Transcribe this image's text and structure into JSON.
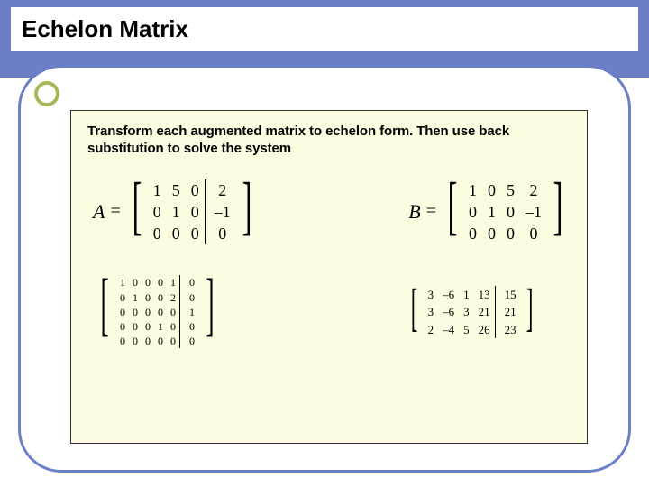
{
  "title": "Echelon Matrix",
  "instruction": "Transform each augmented matrix to echelon form. Then use back substitution to solve the system",
  "matA": {
    "label": "A",
    "rows": [
      [
        "1",
        "5",
        "0",
        "2"
      ],
      [
        "0",
        "1",
        "0",
        "–1"
      ],
      [
        "0",
        "0",
        "0",
        "0"
      ]
    ]
  },
  "matB": {
    "label": "B",
    "rows": [
      [
        "1",
        "0",
        "5",
        "2"
      ],
      [
        "0",
        "1",
        "0",
        "–1"
      ],
      [
        "0",
        "0",
        "0",
        "0"
      ]
    ]
  },
  "matC": {
    "rows": [
      [
        "1",
        "0",
        "0",
        "0",
        "1",
        "0"
      ],
      [
        "0",
        "1",
        "0",
        "0",
        "2",
        "0"
      ],
      [
        "0",
        "0",
        "0",
        "0",
        "0",
        "1"
      ],
      [
        "0",
        "0",
        "0",
        "1",
        "0",
        "0"
      ],
      [
        "0",
        "0",
        "0",
        "0",
        "0",
        "0"
      ]
    ]
  },
  "matD": {
    "rows": [
      [
        "3",
        "–6",
        "1",
        "13",
        "15"
      ],
      [
        "3",
        "–6",
        "3",
        "21",
        "21"
      ],
      [
        "2",
        "–4",
        "5",
        "26",
        "23"
      ]
    ]
  }
}
